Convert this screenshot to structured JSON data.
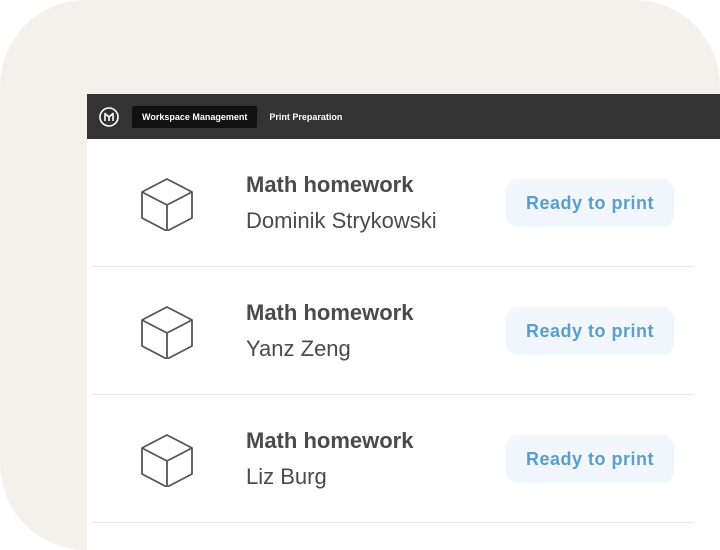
{
  "topbar": {
    "logo_icon": "printer-logo-icon",
    "tabs": [
      {
        "label": "Workspace Management",
        "active": true
      },
      {
        "label": "Print Preparation",
        "active": false
      }
    ]
  },
  "jobs": [
    {
      "icon": "cube-icon",
      "title": "Math homework",
      "user": "Dominik Strykowski",
      "status": "Ready to print"
    },
    {
      "icon": "cube-icon",
      "title": "Math homework",
      "user": "Yanz Zeng",
      "status": "Ready to print"
    },
    {
      "icon": "cube-icon",
      "title": "Math homework",
      "user": "Liz Burg",
      "status": "Ready to print"
    }
  ],
  "colors": {
    "background_card": "#f3f1ec",
    "topbar": "#333333",
    "active_tab": "#111111",
    "badge_bg": "#f0f6fb",
    "badge_text": "#5a9fcc"
  }
}
